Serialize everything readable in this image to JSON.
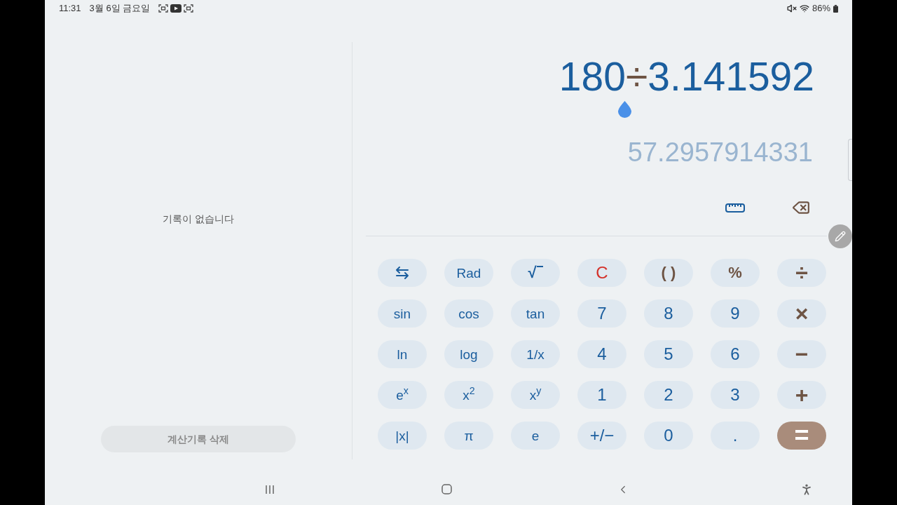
{
  "status_bar": {
    "time": "11:31",
    "date": "3월 6일 금요일",
    "battery": "86%"
  },
  "history": {
    "empty_message": "기록이 없습니다",
    "clear_button": "계산기록 삭제"
  },
  "display": {
    "expression": [
      {
        "text": "180",
        "kind": "number"
      },
      {
        "text": "÷",
        "kind": "operator"
      },
      {
        "text": "3.141592",
        "kind": "number"
      }
    ],
    "result": "57.2957914331"
  },
  "keypad": [
    [
      {
        "kind": "toggle"
      },
      {
        "label": "Rad",
        "kind": "function"
      },
      {
        "label": "√",
        "kind": "root"
      },
      {
        "label": "C",
        "kind": "clear"
      },
      {
        "label": "( )",
        "kind": "symbol"
      },
      {
        "label": "%",
        "kind": "symbol"
      },
      {
        "label": "÷",
        "kind": "operator"
      }
    ],
    [
      {
        "label": "sin",
        "kind": "function"
      },
      {
        "label": "cos",
        "kind": "function"
      },
      {
        "label": "tan",
        "kind": "function"
      },
      {
        "label": "7",
        "kind": "digit"
      },
      {
        "label": "8",
        "kind": "digit"
      },
      {
        "label": "9",
        "kind": "digit"
      },
      {
        "label": "×",
        "kind": "operator"
      }
    ],
    [
      {
        "label": "ln",
        "kind": "function"
      },
      {
        "label": "log",
        "kind": "function"
      },
      {
        "label": "1/x",
        "kind": "function"
      },
      {
        "label": "4",
        "kind": "digit"
      },
      {
        "label": "5",
        "kind": "digit"
      },
      {
        "label": "6",
        "kind": "digit"
      },
      {
        "label": "−",
        "kind": "operator"
      }
    ],
    [
      {
        "label": "e$^{x}$",
        "kind": "function"
      },
      {
        "label": "x$^{2}$",
        "kind": "function"
      },
      {
        "label": "x$^{y}$",
        "kind": "function"
      },
      {
        "label": "1",
        "kind": "digit"
      },
      {
        "label": "2",
        "kind": "digit"
      },
      {
        "label": "3",
        "kind": "digit"
      },
      {
        "label": "+",
        "kind": "operator"
      }
    ],
    [
      {
        "label": "|x|",
        "kind": "function"
      },
      {
        "label": "π",
        "kind": "function"
      },
      {
        "label": "e",
        "kind": "function"
      },
      {
        "label": "+/−",
        "kind": "digit"
      },
      {
        "label": "0",
        "kind": "digit"
      },
      {
        "label": ".",
        "kind": "digit"
      },
      {
        "label": "=",
        "kind": "equals"
      }
    ]
  ]
}
